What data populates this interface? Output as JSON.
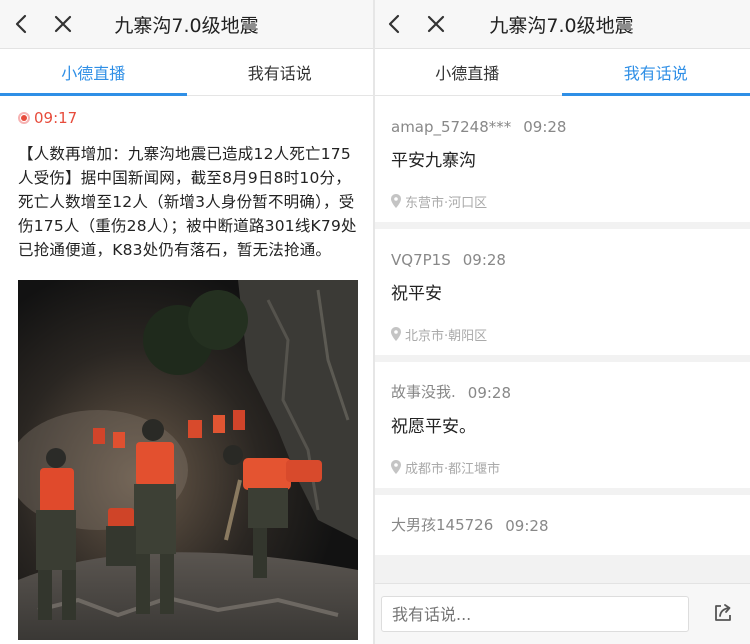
{
  "left": {
    "title": "九寨沟7.0级地震",
    "tabs": [
      {
        "label": "小德直播",
        "active": true
      },
      {
        "label": "我有话说",
        "active": false
      }
    ],
    "live": {
      "time": "09:17",
      "text": "【人数再增加：九寨沟地震已造成12人死亡175人受伤】据中国新闻网，截至8月9日8时10分，死亡人数增至12人（新增3人身份暂不明确），受伤175人（重伤28人）；被中断道路301线K79处已抢通便道，K83处仍有落石，暂无法抢通。",
      "image": "rescue-workers-night-photo"
    }
  },
  "right": {
    "title": "九寨沟7.0级地震",
    "tabs": [
      {
        "label": "小德直播",
        "active": false
      },
      {
        "label": "我有话说",
        "active": true
      }
    ],
    "comments": [
      {
        "user": "amap_57248***",
        "time": "09:28",
        "text": "平安九寨沟",
        "location": "东营市·河口区"
      },
      {
        "user": "VQ7P1S",
        "time": "09:28",
        "text": "祝平安",
        "location": "北京市·朝阳区"
      },
      {
        "user": "故事没我.",
        "time": "09:28",
        "text": "祝愿平安。",
        "location": "成都市·都江堰市"
      },
      {
        "user": "大男孩145726",
        "time": "09:28"
      }
    ],
    "input_placeholder": "我有话说..."
  },
  "colors": {
    "accent": "#2f8fe6",
    "live_red": "#e74c3c"
  },
  "icons": [
    "back-arrow-icon",
    "close-icon",
    "record-dot-icon",
    "location-pin-icon",
    "share-icon"
  ]
}
